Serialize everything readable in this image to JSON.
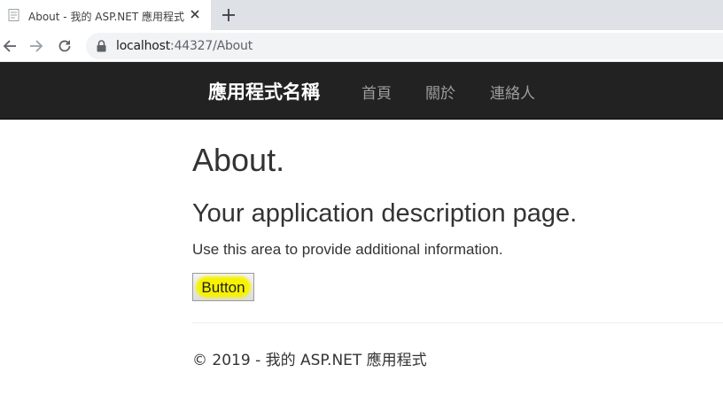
{
  "browser": {
    "tab_title": "About - 我的 ASP.NET 應用程式",
    "url_host": "localhost",
    "url_rest": ":44327/About"
  },
  "navbar": {
    "brand": "應用程式名稱",
    "links": [
      {
        "label": "首頁"
      },
      {
        "label": "關於"
      },
      {
        "label": "連絡人"
      }
    ]
  },
  "main": {
    "title": "About.",
    "subtitle": "Your application description page.",
    "info": "Use this area to provide additional information.",
    "button_label": "Button"
  },
  "footer": {
    "text": "© 2019 - 我的 ASP.NET 應用程式"
  },
  "colors": {
    "navbar_bg": "#222222",
    "nav_link": "#9d9d9d",
    "button_highlight": "#f7f200"
  }
}
